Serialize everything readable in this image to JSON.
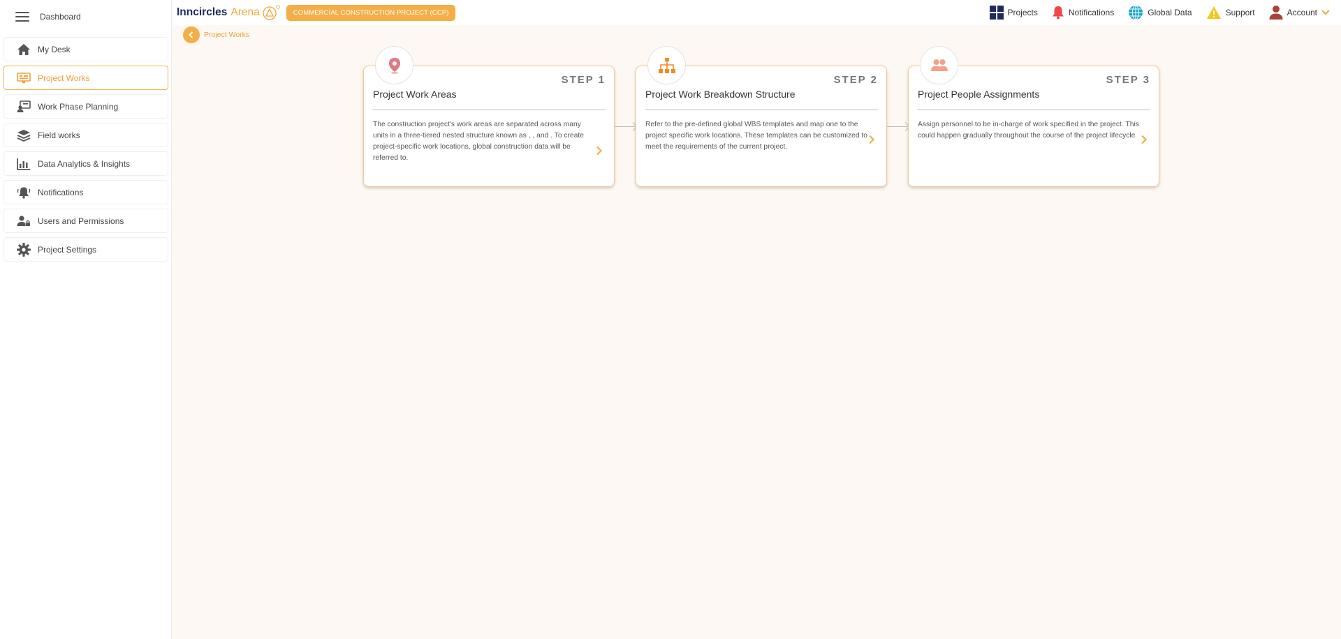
{
  "sidebar": {
    "header_label": "Dashboard",
    "items": [
      {
        "label": "My Desk",
        "icon": "home-icon"
      },
      {
        "label": "Project Works",
        "icon": "project-works-icon",
        "active": true
      },
      {
        "label": "Work Phase Planning",
        "icon": "work-phase-icon"
      },
      {
        "label": "Field works",
        "icon": "layers-icon"
      },
      {
        "label": "Data Analytics & Insights",
        "icon": "bar-chart-icon"
      },
      {
        "label": "Notifications",
        "icon": "bell-icon"
      },
      {
        "label": "Users and Permissions",
        "icon": "user-lock-icon"
      },
      {
        "label": "Project Settings",
        "icon": "gear-icon"
      }
    ]
  },
  "header": {
    "logo_part1": "Inncircles",
    "logo_part2": "Arena",
    "logo_sup": "(R)",
    "project_name": "COMMERCIAL CONSTRUCTION PROJECT (CCP)",
    "nav": {
      "projects": "Projects",
      "notifications": "Notifications",
      "global_data": "Global Data",
      "support": "Support",
      "account": "Account"
    }
  },
  "breadcrumb": {
    "label": "Project Works"
  },
  "steps": [
    {
      "step": "STEP 1",
      "title": "Project Work Areas",
      "description": "The construction project's work areas are separated across many units in a three-tiered nested structure known as , , and . To create project-specific work locations, global construction data will be referred to.",
      "icon": "location-pin-icon"
    },
    {
      "step": "STEP 2",
      "title": "Project Work Breakdown Structure",
      "description": "Refer to the pre-defined global WBS templates and map one to the project specific work locations. These templates can be customized to meet the requirements of the current project.",
      "icon": "org-chart-icon"
    },
    {
      "step": "STEP 3",
      "title": "Project People Assignments",
      "description": "Assign personnel to be in-charge of work specified in the project. This could happen gradually throughout the course of the project lifecycle",
      "icon": "people-icon"
    }
  ],
  "colors": {
    "accent": "#f4ae48",
    "accent_text": "#f0a031",
    "card_border": "#f6c990",
    "background": "#fdf8f3",
    "brand_navy": "#1f2a5c"
  }
}
